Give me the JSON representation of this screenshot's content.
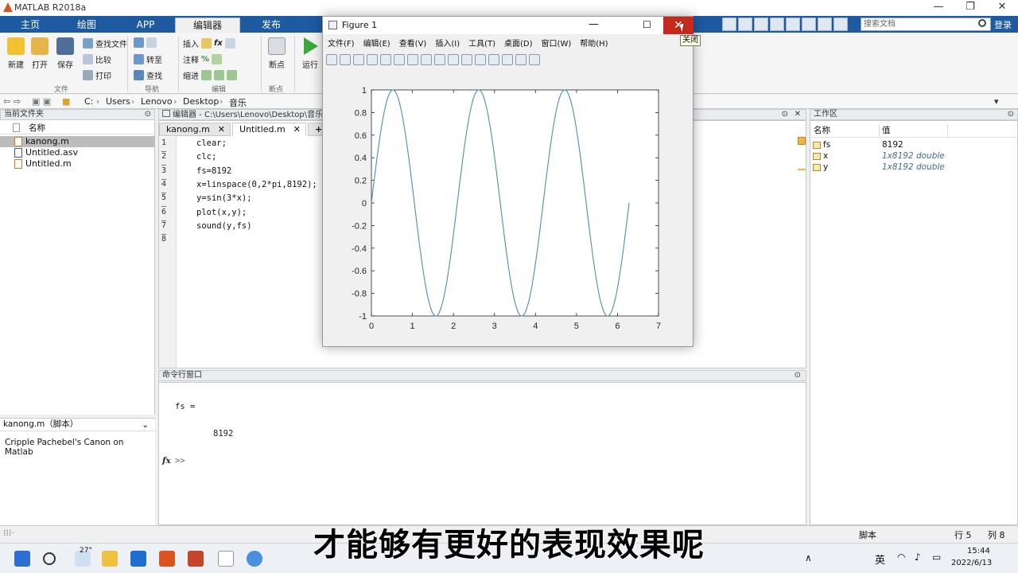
{
  "app": {
    "title": "MATLAB R2018a"
  },
  "tabs": [
    "主页",
    "绘图",
    "APP",
    "编辑器",
    "发布"
  ],
  "search": {
    "placeholder": "搜索文档",
    "login": "登录"
  },
  "ribbon": {
    "new": "新建",
    "open": "打开",
    "save": "保存",
    "find_files": "查找文件",
    "compare": "比较",
    "print": "打印",
    "goto": "转至",
    "find": "查找",
    "insert": "插入",
    "comment": "注释",
    "indent": "缩进",
    "breakpoints": "断点",
    "run": "运行",
    "groups": {
      "file": "文件",
      "navigate": "导航",
      "edit": "编辑",
      "breakpoints": "断点"
    }
  },
  "address": {
    "path": [
      "C:",
      "Users",
      "Lenovo",
      "Desktop",
      "音乐"
    ]
  },
  "current_folder": {
    "title": "当前文件夹",
    "column": "名称",
    "files": [
      "kanong.m",
      "Untitled.asv",
      "Untitled.m"
    ]
  },
  "details": {
    "title": "kanong.m（脚本）",
    "text": "Cripple Pachebel's Canon on Matlab"
  },
  "editor": {
    "title": "编辑器 - C:\\Users\\Lenovo\\Desktop\\音乐",
    "tabs": [
      "kanong.m",
      "Untitled.m"
    ],
    "lines": [
      "clear;",
      "clc;",
      "fs=8192",
      "x=linspace(0,2*pi,8192);",
      "y=sin(3*x);",
      "plot(x,y);",
      "sound(y,fs)",
      ""
    ]
  },
  "command": {
    "title": "命令行窗口",
    "out1": "fs =",
    "out2": "8192",
    "prompt": ">>"
  },
  "workspace": {
    "title": "工作区",
    "col_name": "名称",
    "col_value": "值",
    "vars": [
      {
        "name": "fs",
        "value": "8192"
      },
      {
        "name": "x",
        "value": "1x8192 double"
      },
      {
        "name": "y",
        "value": "1x8192 double"
      }
    ]
  },
  "status": {
    "mode": "脚本",
    "row": "行 5",
    "col": "列 8"
  },
  "taskbar": {
    "weather": "27°",
    "lang": "英",
    "time": "15:44",
    "date": "2022/6/13"
  },
  "figure": {
    "title": "Figure 1",
    "menu": [
      "文件(F)",
      "编辑(E)",
      "查看(V)",
      "插入(I)",
      "工具(T)",
      "桌面(D)",
      "窗口(W)",
      "帮助(H)"
    ],
    "close_tooltip": "关闭"
  },
  "chart_data": {
    "type": "line",
    "title": "",
    "xlabel": "",
    "ylabel": "",
    "xlim": [
      0,
      7
    ],
    "ylim": [
      -1,
      1
    ],
    "xticks": [
      "0",
      "1",
      "2",
      "3",
      "4",
      "5",
      "6",
      "7"
    ],
    "yticks": [
      "1",
      "0.8",
      "0.6",
      "0.4",
      "0.2",
      "0",
      "-0.2",
      "-0.4",
      "-0.6",
      "-0.8",
      "-1"
    ],
    "series": [
      {
        "function": "y=sin(3*x)",
        "x_range": [
          0,
          6.2832
        ],
        "samples": 8192,
        "color": "#4a90b0"
      }
    ]
  },
  "caption": "才能够有更好的表现效果呢"
}
